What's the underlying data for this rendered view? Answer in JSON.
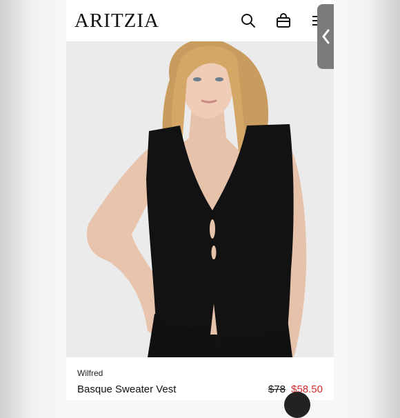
{
  "header": {
    "logo": "ARITZIA",
    "icons": [
      "search-icon",
      "bag-icon",
      "menu-icon"
    ]
  },
  "product": {
    "brand": "Wilfred",
    "name": "Basque Sweater Vest",
    "original_price": "$78",
    "sale_price": "$58.50"
  },
  "colors": {
    "sale_price": "#d42a2a",
    "vest": "#121212",
    "side_tab": "#7b7b7b"
  },
  "side_tab": {
    "icon": "chevron-left-icon"
  }
}
